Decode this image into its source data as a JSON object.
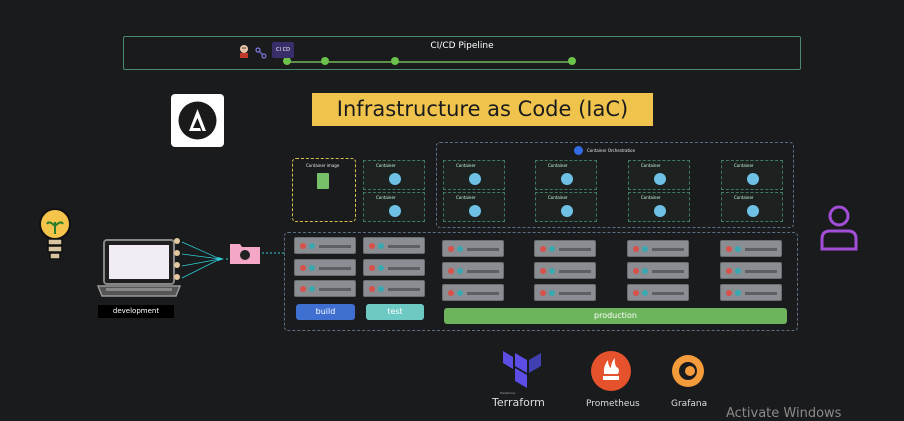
{
  "pipeline": {
    "title": "CI/CD Pipeline",
    "ci_cd_badge": "CI CD"
  },
  "header": {
    "title": "Infrastructure as Code (IaC)"
  },
  "container_image": {
    "label": "Container image"
  },
  "orchestration": {
    "label": "Container Orchestration"
  },
  "container_label": "Container",
  "environments": {
    "build": "build",
    "test": "test",
    "production": "production"
  },
  "development": {
    "label": "development"
  },
  "tools": [
    {
      "name": "Terraform",
      "sub": "HashiCorp"
    },
    {
      "name": "Prometheus"
    },
    {
      "name": "Grafana"
    }
  ],
  "watermark": "Activate Windows",
  "colors": {
    "accent": "#f0c44c",
    "build": "#3f6fd1",
    "test": "#6cc9c3",
    "production": "#6db55c",
    "terraform": "#5c4ee5",
    "prometheus": "#e6522c",
    "grafana": "#f49b3c"
  }
}
